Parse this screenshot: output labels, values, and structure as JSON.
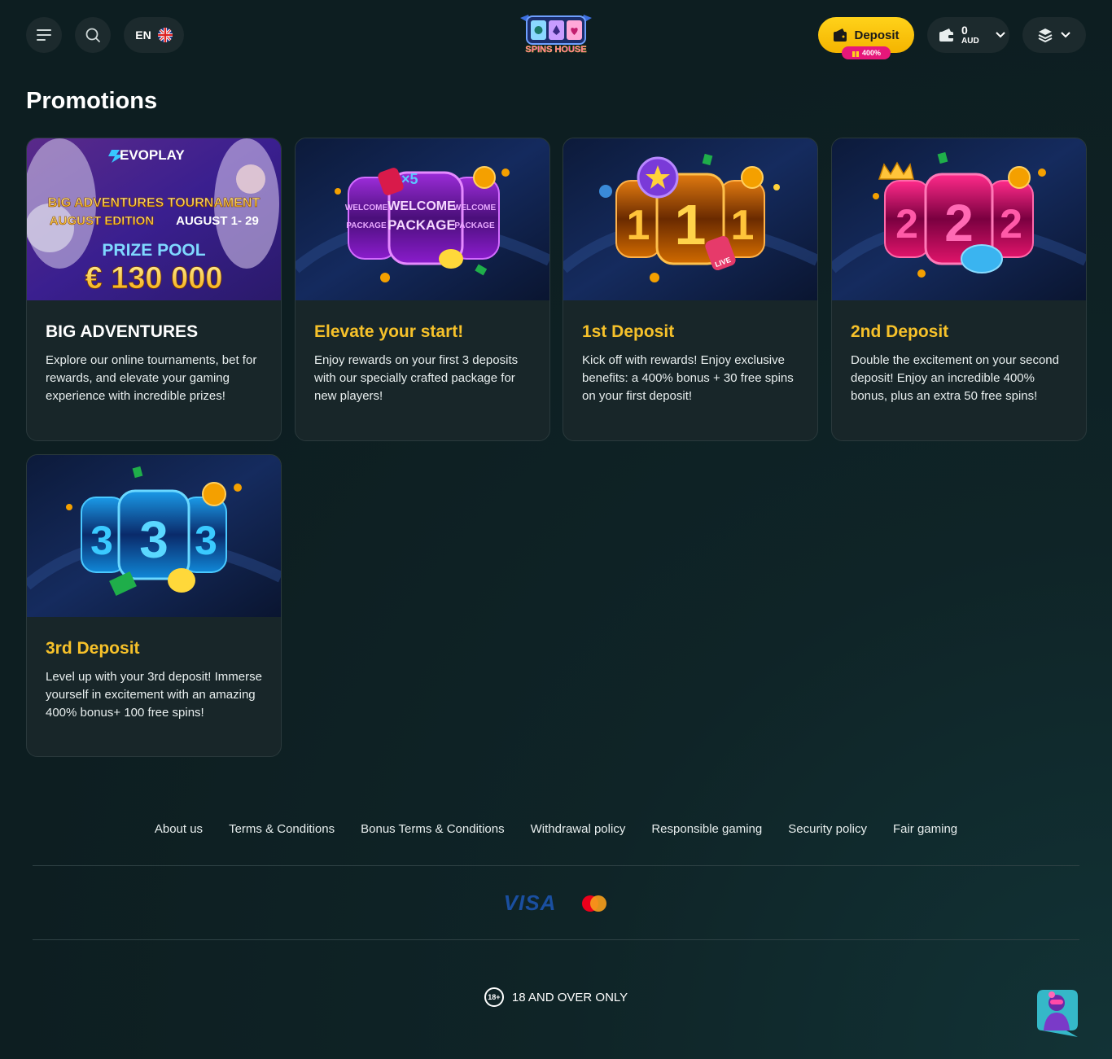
{
  "header": {
    "menu_icon": "hamburger-menu-icon",
    "search_icon": "search-icon",
    "language": "EN",
    "language_flag": "uk-flag-icon",
    "logo_text": "SPINS HOUSE",
    "deposit_label": "Deposit",
    "deposit_badge": "400%",
    "balance_amount": "0",
    "balance_currency": "AUD",
    "profile_icon": "vip-rank-icon"
  },
  "page": {
    "title": "Promotions"
  },
  "banners": {
    "evoplay_brand": "EVOPLAY",
    "evoplay_line1": "BIG ADVENTURES TOURNAMENT",
    "evoplay_line2a": "AUGUST EDITION",
    "evoplay_line2b": "AUGUST 1- 29",
    "evoplay_line3": "PRIZE POOL",
    "evoplay_line4": "€ 130 000",
    "welcome_center_1": "WELCOME",
    "welcome_center_2": "PACKAGE",
    "welcome_side_1": "WELCOME",
    "welcome_side_2": "PACKAGE",
    "welcome_mult": "×5",
    "live_tag": "LIVE",
    "reel_1": "1",
    "reel_2": "2",
    "reel_3": "3"
  },
  "promotions": [
    {
      "title": "BIG ADVENTURES",
      "description": "Explore our online tournaments, bet for rewards, and elevate your gaming experience with incredible prizes!"
    },
    {
      "title": "Elevate your start!",
      "description": "Enjoy rewards on your first 3 deposits with our specially crafted package for new players!"
    },
    {
      "title": "1st Deposit",
      "description": "Kick off with rewards! Enjoy exclusive benefits: a 400% bonus + 30 free spins on your first deposit!"
    },
    {
      "title": "2nd Deposit",
      "description": "Double the excitement on your second deposit! Enjoy an incredible 400% bonus, plus an extra 50 free spins!"
    },
    {
      "title": "3rd Deposit",
      "description": "Level up with your 3rd deposit! Immerse yourself in excitement with an amazing 400% bonus+ 100 free spins!"
    }
  ],
  "footer": {
    "links": [
      "About us",
      "Terms & Conditions",
      "Bonus Terms & Conditions",
      "Withdrawal policy",
      "Responsible gaming",
      "Security policy",
      "Fair gaming"
    ],
    "payment_visa": "VISA",
    "payment_mastercard": "mastercard-icon",
    "age_badge": "18+",
    "age_text": "18 AND OVER ONLY",
    "chat_icon": "support-chat-avatar-icon"
  },
  "colors": {
    "background": "#0f2326",
    "accent_yellow": "#f6c12a",
    "badge_pink": "#e6177a",
    "card_bg": "#182629"
  }
}
